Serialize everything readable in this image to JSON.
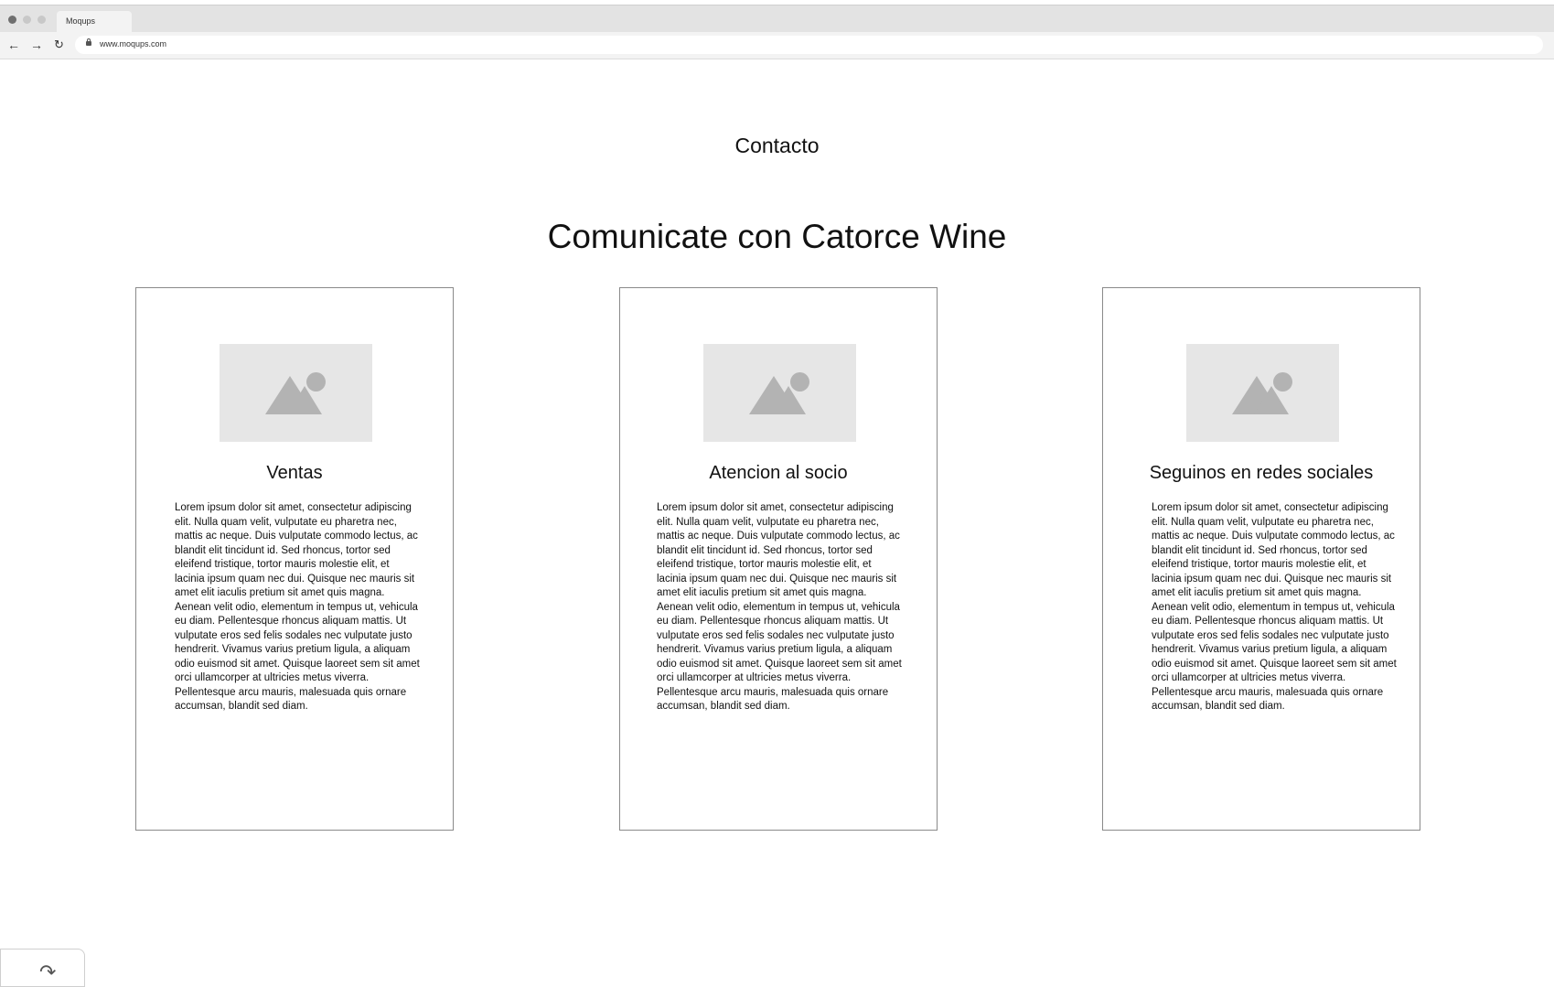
{
  "browser": {
    "tab_title": "Moqups",
    "url": "www.moqups.com",
    "icons": [
      "back-arrow-icon",
      "forward-arrow-icon",
      "reload-icon",
      "lock-icon"
    ]
  },
  "page": {
    "heading": "Contacto",
    "title": "Comunicate con Catorce Wine"
  },
  "cards": [
    {
      "title": "Ventas",
      "image_icon": "image-placeholder-icon",
      "text": "Lorem ipsum dolor sit amet, consectetur adipiscing elit. Nulla quam velit, vulputate eu pharetra nec, mattis ac neque. Duis vulputate commodo lectus, ac blandit elit tincidunt id. Sed rhoncus, tortor sed eleifend tristique, tortor mauris molestie elit, et lacinia ipsum quam nec dui. Quisque nec mauris sit amet elit iaculis pretium sit amet quis magna. Aenean velit odio, elementum in tempus ut, vehicula eu diam. Pellentesque rhoncus aliquam mattis. Ut vulputate eros sed felis sodales nec vulputate justo hendrerit. Vivamus varius pretium ligula, a aliquam odio euismod sit amet. Quisque laoreet sem sit amet orci ullamcorper at ultricies metus viverra. Pellentesque arcu mauris, malesuada quis ornare accumsan, blandit sed diam."
    },
    {
      "title": "Atencion al socio",
      "image_icon": "image-placeholder-icon",
      "text": "Lorem ipsum dolor sit amet, consectetur adipiscing elit. Nulla quam velit, vulputate eu pharetra nec, mattis ac neque. Duis vulputate commodo lectus, ac blandit elit tincidunt id. Sed rhoncus, tortor sed eleifend tristique, tortor mauris molestie elit, et lacinia ipsum quam nec dui. Quisque nec mauris sit amet elit iaculis pretium sit amet quis magna. Aenean velit odio, elementum in tempus ut, vehicula eu diam. Pellentesque rhoncus aliquam mattis. Ut vulputate eros sed felis sodales nec vulputate justo hendrerit. Vivamus varius pretium ligula, a aliquam odio euismod sit amet. Quisque laoreet sem sit amet orci ullamcorper at ultricies metus viverra. Pellentesque arcu mauris, malesuada quis ornare accumsan, blandit sed diam."
    },
    {
      "title": "Seguinos en redes sociales",
      "image_icon": "image-placeholder-icon",
      "text": "Lorem ipsum dolor sit amet, consectetur adipiscing elit. Nulla quam velit, vulputate eu pharetra nec, mattis ac neque. Duis vulputate commodo lectus, ac blandit elit tincidunt id. Sed rhoncus, tortor sed eleifend tristique, tortor mauris molestie elit, et lacinia ipsum quam nec dui. Quisque nec mauris sit amet elit iaculis pretium sit amet quis magna. Aenean velit odio, elementum in tempus ut, vehicula eu diam. Pellentesque rhoncus aliquam mattis. Ut vulputate eros sed felis sodales nec vulputate justo hendrerit. Vivamus varius pretium ligula, a aliquam odio euismod sit amet. Quisque laoreet sem sit amet orci ullamcorper at ultricies metus viverra. Pellentesque arcu mauris, malesuada quis ornare accumsan, blandit sed diam."
    }
  ],
  "corner_widget": {
    "icon": "redo-arrow-icon"
  }
}
